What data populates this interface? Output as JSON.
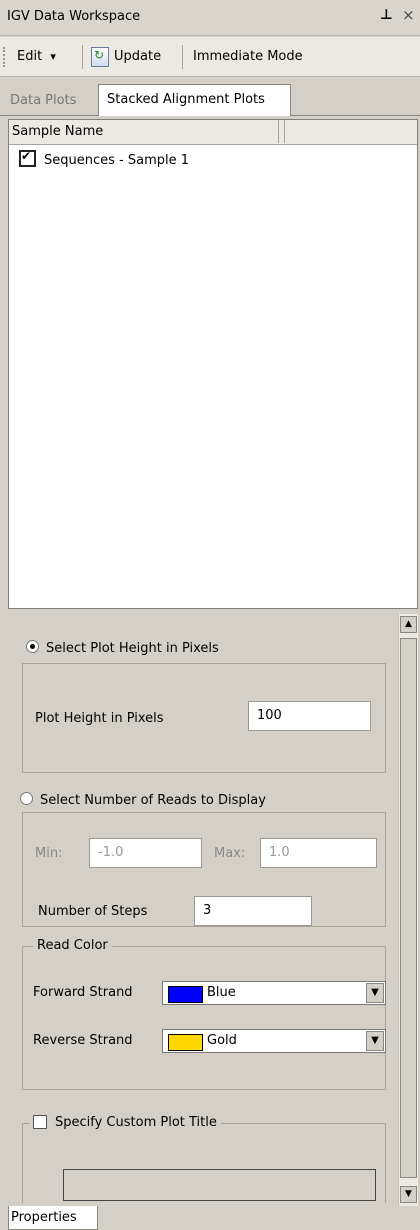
{
  "window": {
    "title": "IGV Data Workspace",
    "pin_glyph": "⊥",
    "close_glyph": "×"
  },
  "toolbar": {
    "edit_label": "Edit",
    "edit_arrow": "▾",
    "update_label": "Update",
    "immediate_label": "Immediate Mode"
  },
  "tabs": [
    {
      "label": "Data Plots"
    },
    {
      "label": "Stacked Alignment Plots"
    }
  ],
  "list": {
    "column_header": "Sample Name",
    "rows": [
      {
        "label": "Sequences - Sample 1",
        "checked": true
      }
    ]
  },
  "properties": {
    "plot_height_radio": "Select Plot Height in Pixels",
    "plot_height_label": "Plot Height in Pixels",
    "plot_height_value": "100",
    "reads_radio": "Select Number of Reads to Display",
    "min_label": "Min:",
    "min_value": "-1.0",
    "max_label": "Max:",
    "max_value": "1.0",
    "steps_label": "Number of Steps",
    "steps_value": "3",
    "read_color_legend": "Read Color",
    "forward_label": "Forward Strand",
    "forward_value": "Blue",
    "forward_color": "#0000ff",
    "reverse_label": "Reverse Strand",
    "reverse_value": "Gold",
    "reverse_color": "#ffd700",
    "custom_title_label": "Specify Custom Plot Title",
    "custom_title_value": ""
  },
  "bottom_tab": {
    "label": "Properties"
  }
}
